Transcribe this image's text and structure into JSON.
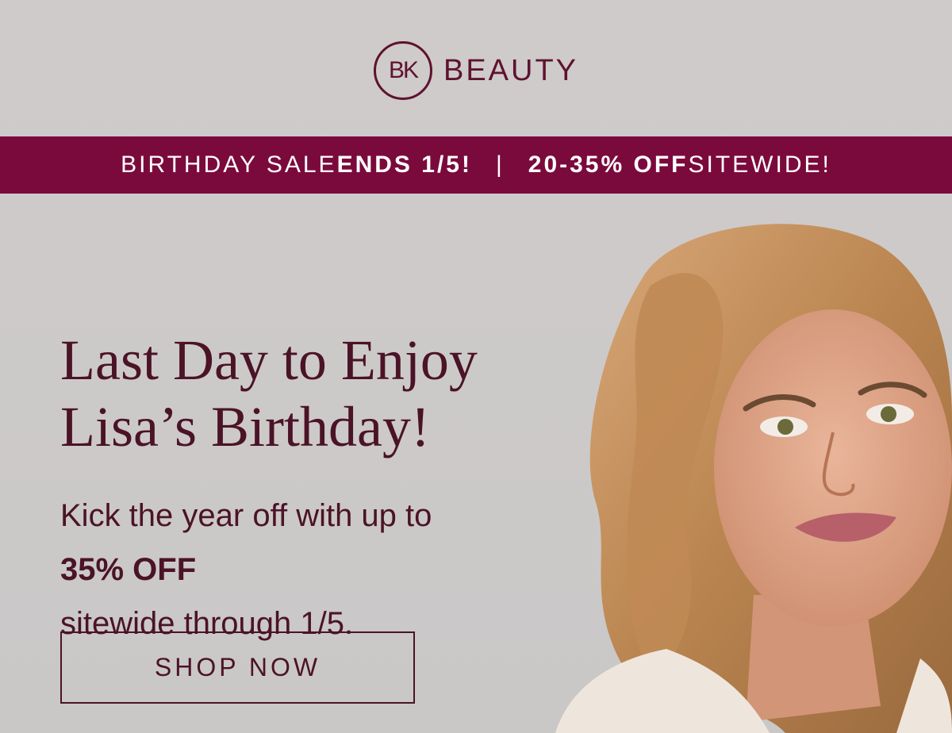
{
  "brand": {
    "logo_mark": "BK",
    "name": "BEAUTY",
    "color": "#5e1230"
  },
  "banner": {
    "part1_regular": "BIRTHDAY SALE ",
    "part1_bold": "ENDS 1/5!",
    "separator": "|",
    "part2_bold": "20-35% OFF",
    "part2_regular": " SITEWIDE!",
    "background": "#7b0a3c"
  },
  "hero": {
    "headline_line1": "Last Day to Enjoy",
    "headline_line2": "Lisa’s Birthday!",
    "sub_line1": "Kick the year off with up to",
    "sub_line2_bold": "35% OFF",
    "sub_line2_regular": " sitewide through 1/5.",
    "text_color": "#4b1327"
  },
  "cta": {
    "label": "SHOP NOW"
  },
  "image": {
    "icon": "portrait-photo"
  }
}
